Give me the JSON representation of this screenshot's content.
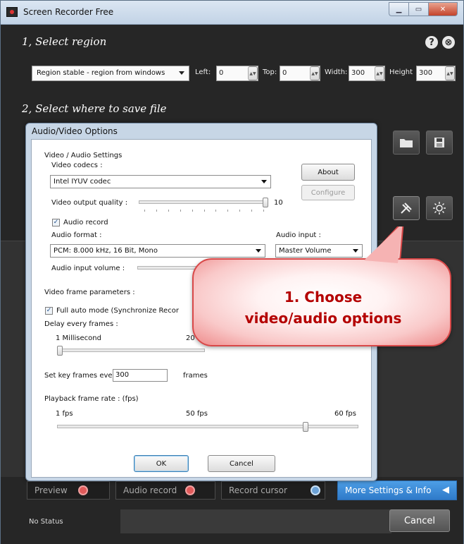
{
  "window": {
    "title": "Screen Recorder Free"
  },
  "section1": {
    "title": "1, Select region",
    "help_icon": "?",
    "close_icon": "⊗"
  },
  "region": {
    "mode": "Region stable - region from windows",
    "left_label": "Left:",
    "left_value": "0",
    "top_label": "Top:",
    "top_value": "0",
    "width_label": "Width:",
    "width_value": "300",
    "height_label": "Height",
    "height_value": "300"
  },
  "section2": {
    "title": "2, Select where to save file"
  },
  "dialog": {
    "title": "Audio/Video Options",
    "group_label": "Video / Audio Settings",
    "video_codecs_label": "Video codecs :",
    "video_codec": "Intel IYUV codec",
    "about_button": "About",
    "configure_button": "Configure",
    "video_quality_label": "Video output quality :",
    "video_quality_value": "10",
    "audio_record_label": "Audio record",
    "audio_format_label": "Audio format :",
    "audio_format": "PCM: 8.000 kHz, 16 Bit, Mono",
    "audio_input_label": "Audio input :",
    "audio_input": "Master Volume",
    "audio_volume_label": "Audio input volume :",
    "frame_params_label": "Video frame parameters :",
    "full_auto_label": "Full auto mode (Synchronize  Recor",
    "delay_label": "Delay every frames :",
    "delay_min": "1 Millisecond",
    "delay_mid": "20",
    "key_frames_label": "Set key frames every",
    "key_frames_value": "300",
    "key_frames_unit": "frames",
    "playback_label": "Playback frame rate : (fps)",
    "fps_min": "1 fps",
    "fps_mid": "50 fps",
    "fps_max": "60 fps",
    "ok_button": "OK",
    "cancel_button": "Cancel"
  },
  "callout": {
    "line1": "1. Choose",
    "line2": "video/audio options"
  },
  "bottom": {
    "preview": "Preview",
    "audio_record": "Audio record",
    "record_cursor": "Record cursor",
    "more_settings": "More Settings & Info"
  },
  "status": {
    "text": "No Status",
    "cancel": "Cancel"
  },
  "levels": {
    "video_quality_fraction": 1.0,
    "delay_fraction": 0.0,
    "playback_fraction": 0.83
  },
  "colors": {
    "app_bg": "#262626",
    "dialog_frame": "#c7d6e6",
    "accent_blue": "#2f7ac9",
    "callout_red": "#b40000"
  }
}
